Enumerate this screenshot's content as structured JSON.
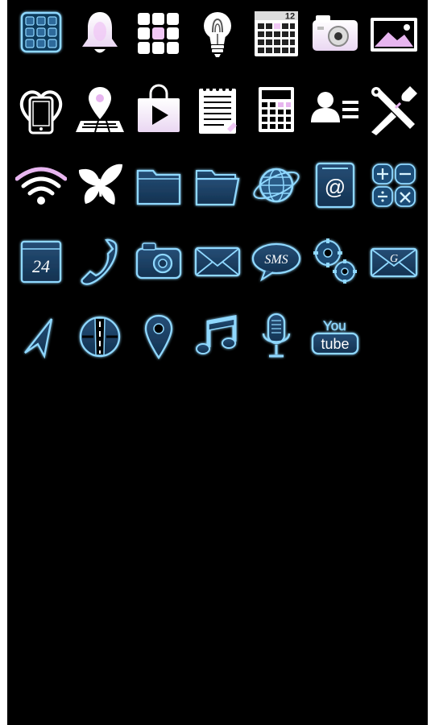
{
  "screen": {
    "background": "#000000",
    "frame_color": "#ffffff"
  },
  "theme": {
    "white_icon": "#ffffff",
    "pink_accent": "#e6b3f0",
    "blue_fill": "#1b3b5c",
    "neon_glow": "#8fd8ff"
  },
  "icons": {
    "row1": [
      "apps-grid-icon",
      "bell-icon",
      "dots-grid-icon",
      "lightbulb-icon",
      "calendar-icon",
      "camera-icon",
      "gallery-icon"
    ],
    "row2": [
      "heart-phone-icon",
      "map-pin-icon",
      "play-store-icon",
      "notepad-icon",
      "calculator-icon",
      "contacts-icon",
      "tools-icon"
    ],
    "row3": [
      "wifi-icon",
      "butterfly-icon",
      "folder-icon",
      "folder-open-icon",
      "globe-icon",
      "email-icon",
      "calculator-buttons-icon"
    ],
    "row4": [
      "calendar-24-icon",
      "phone-icon",
      "camera-icon",
      "mail-icon",
      "sms-icon",
      "settings-icon",
      "gmail-icon"
    ],
    "row5": [
      "navigation-icon",
      "road-globe-icon",
      "location-pin-icon",
      "music-note-icon",
      "microphone-icon",
      "youtube-icon"
    ]
  },
  "labels": {
    "calendar_date": "12",
    "calendar_24": "24",
    "email_at": "@",
    "sms": "SMS",
    "gmail_letter": "G",
    "youtube_you": "You",
    "youtube_tube": "tube"
  }
}
